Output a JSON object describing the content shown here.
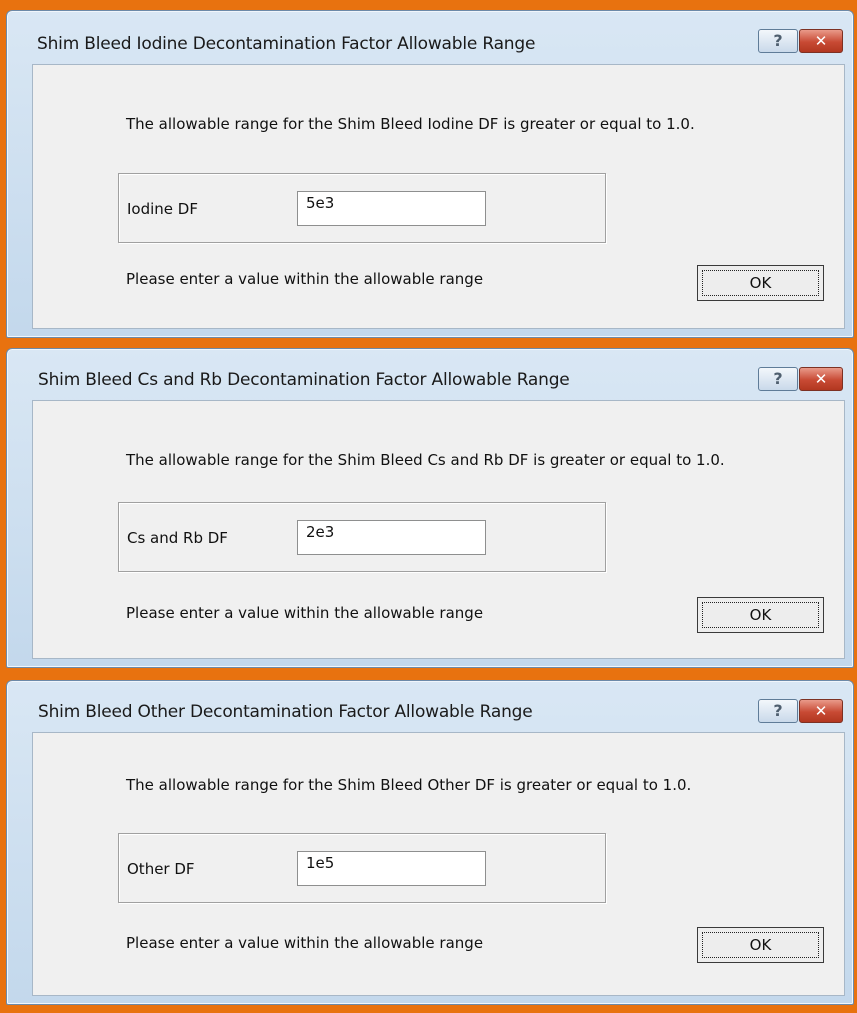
{
  "dialogs": [
    {
      "title": "Shim Bleed Iodine Decontamination Factor Allowable Range",
      "help_label": "?",
      "close_label": "✕",
      "description": "The allowable range for the Shim Bleed Iodine DF is greater or equal to 1.0.",
      "field_label": "Iodine DF",
      "field_value": "5e3",
      "hint": "Please enter a value within the allowable range",
      "ok_label": "OK"
    },
    {
      "title": "Shim Bleed Cs and Rb Decontamination Factor Allowable Range",
      "help_label": "?",
      "close_label": "✕",
      "description": "The allowable range for the Shim Bleed Cs and Rb DF is greater or equal to 1.0.",
      "field_label": "Cs and Rb DF",
      "field_value": "2e3",
      "hint": "Please enter a value within the allowable range",
      "ok_label": "OK"
    },
    {
      "title": "Shim Bleed Other Decontamination Factor Allowable Range",
      "help_label": "?",
      "close_label": "✕",
      "description": "The allowable range for the Shim Bleed Other DF is greater or equal to 1.0.",
      "field_label": "Other DF",
      "field_value": "1e5",
      "hint": "Please enter a value within the allowable range",
      "ok_label": "OK"
    }
  ],
  "colors": {
    "background": "#e8720f",
    "titlebar": "#c3d8ec",
    "close_button": "#c84a34",
    "client_area": "#f0f0f0"
  }
}
